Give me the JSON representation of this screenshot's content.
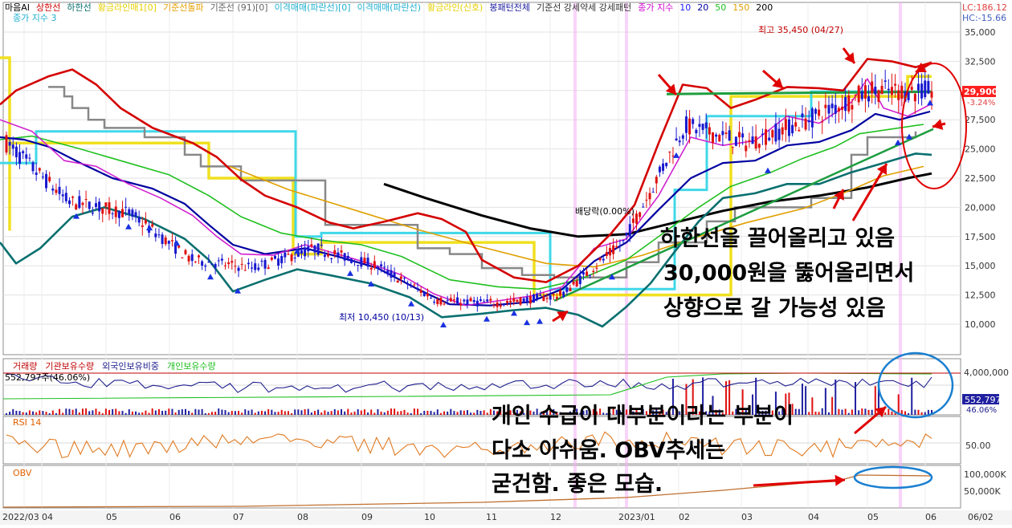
{
  "legend_top": [
    {
      "label": "마음AI",
      "color": "#000000"
    },
    {
      "label": "상한선",
      "color": "#d40000"
    },
    {
      "label": "하한선",
      "color": "#0a6f6f"
    },
    {
      "label": "황금라인매1[0]",
      "color": "#e6d000"
    },
    {
      "label": "기준선돌파",
      "color": "#e6a000"
    },
    {
      "label": "기준선 (91)[0]",
      "color": "#666666"
    },
    {
      "label": "이격매매(파란선)[0]",
      "color": "#20b0d0"
    },
    {
      "label": "이격매매(파란선)",
      "color": "#20b0d0"
    },
    {
      "label": "황금라인(신호)",
      "color": "#e6d000"
    },
    {
      "label": "봉패턴전체",
      "color": "#2020a0"
    },
    {
      "label": "기준선 강세약세 강세패턴",
      "color": "#333333"
    },
    {
      "label": "종가 지수",
      "color": "#d000d0"
    },
    {
      "label": "10",
      "color": "#2020ff"
    },
    {
      "label": "20",
      "color": "#0000a0"
    },
    {
      "label": "50",
      "color": "#20c020"
    },
    {
      "label": "150",
      "color": "#e0a000"
    },
    {
      "label": "200",
      "color": "#000000"
    }
  ],
  "legend_sub": "종가 지수 3",
  "indicator_corner": {
    "lc": "LC:186.12",
    "hc": "HC:-15.66"
  },
  "price_panel": {
    "y_ticks": [
      "35,000",
      "32,500",
      "30,000",
      "27,500",
      "25,000",
      "22,500",
      "20,000",
      "17,500",
      "15,000",
      "12,500",
      "10,000"
    ],
    "current_price": "29,900",
    "current_change": "-3.24%",
    "high_label": "최고 35,450 (04/27)",
    "low_label": "최저 10,450 (10/13)",
    "dividend_label": "배당락(0.00%)"
  },
  "volume_panel": {
    "legend": [
      {
        "label": "거래량",
        "color": "#c00000"
      },
      {
        "label": "기관보유수량",
        "color": "#c00000"
      },
      {
        "label": "외국인보유비중",
        "color": "#20208f"
      },
      {
        "label": "개인보유수량",
        "color": "#20c020"
      }
    ],
    "readout": "552,797주(46.06%)",
    "y_ticks": [
      "4,000,000"
    ],
    "current_value": "552,797",
    "current_pct": "46.06%"
  },
  "rsi_panel": {
    "label": "RSI 14",
    "y_ticks": [
      "50.00"
    ]
  },
  "obv_panel": {
    "label": "OBV",
    "y_ticks": [
      "100,000K",
      "50,000K"
    ]
  },
  "x_axis": [
    "2022/03",
    "04",
    "05",
    "06",
    "07",
    "08",
    "09",
    "10",
    "11",
    "12",
    "2023/01",
    "02",
    "03",
    "04",
    "05",
    "06",
    "06/02"
  ],
  "annotations": {
    "main_1": "하한선을 끌어올리고 있음",
    "main_2": "30,000원을 뚫어올리면서",
    "main_3": "상향으로 갈 가능성 있음",
    "lower_1": "개인 수급이 대부분이라는 부분이",
    "lower_2": "다소 아쉬움. OBV추세는",
    "lower_3": "굳건함. 좋은 모습."
  },
  "chart_data": {
    "type": "line",
    "title": "",
    "x": [
      "2022/03",
      "04",
      "05",
      "06",
      "07",
      "08",
      "09",
      "10",
      "11",
      "12",
      "2023/01",
      "02",
      "03",
      "04",
      "05",
      "06"
    ],
    "ylim": [
      9000,
      36000
    ],
    "series": [
      {
        "name": "종가 지수",
        "values": [
          25500,
          20500,
          19500,
          15500,
          14800,
          16500,
          15000,
          12000,
          11800,
          12500,
          17000,
          27000,
          25500,
          27500,
          30000,
          29900
        ]
      }
    ],
    "extremes": {
      "high": 35450,
      "high_date": "04/27",
      "low": 10450,
      "low_date": "10/13"
    },
    "current": 29900,
    "change_pct": -3.24,
    "subcharts": [
      {
        "name": "거래량",
        "current": 552797,
        "unit": "주",
        "pct": 46.06,
        "y_ticks": [
          4000000
        ]
      },
      {
        "name": "RSI 14",
        "y_ticks": [
          50
        ]
      },
      {
        "name": "OBV",
        "y_ticks": [
          100000,
          50000
        ],
        "unit": "K"
      }
    ]
  },
  "colors": {
    "upper_band": "#d40000",
    "lower_band": "#0a6f6f",
    "ma10": "#2020ff",
    "ma20": "#0000a0",
    "ma50": "#20c020",
    "ma150": "#e0a000",
    "ma200": "#000000",
    "baseline": "#888888",
    "golden": "#f0e020",
    "cyan": "#40d8e8",
    "annotation_red": "#e00000",
    "circle_blue": "#1a7fd0"
  }
}
